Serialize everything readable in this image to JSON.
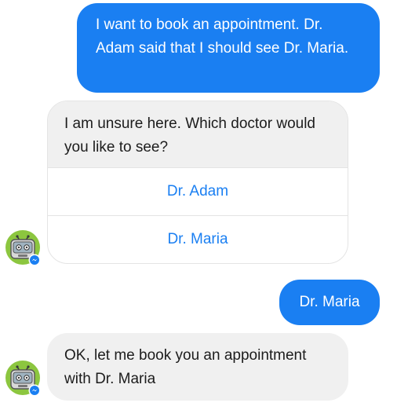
{
  "colors": {
    "accent": "#1a7ff2",
    "bot_bubble": "#f0f0f0",
    "user_text": "#ffffff"
  },
  "messages": [
    {
      "from": "user",
      "text": "I want to book an appointment. Dr. Adam said that I should see Dr. Maria."
    },
    {
      "from": "bot",
      "text": "I am unsure here. Which doctor would you like to see?",
      "quick_replies": [
        "Dr. Adam",
        "Dr. Maria"
      ]
    },
    {
      "from": "user",
      "text": "Dr. Maria"
    },
    {
      "from": "bot",
      "text": "OK, let me book you an appointment with Dr. Maria"
    }
  ],
  "avatar": {
    "icon": "robot-bot-avatar-icon",
    "badge_icon": "messenger-badge-icon"
  }
}
